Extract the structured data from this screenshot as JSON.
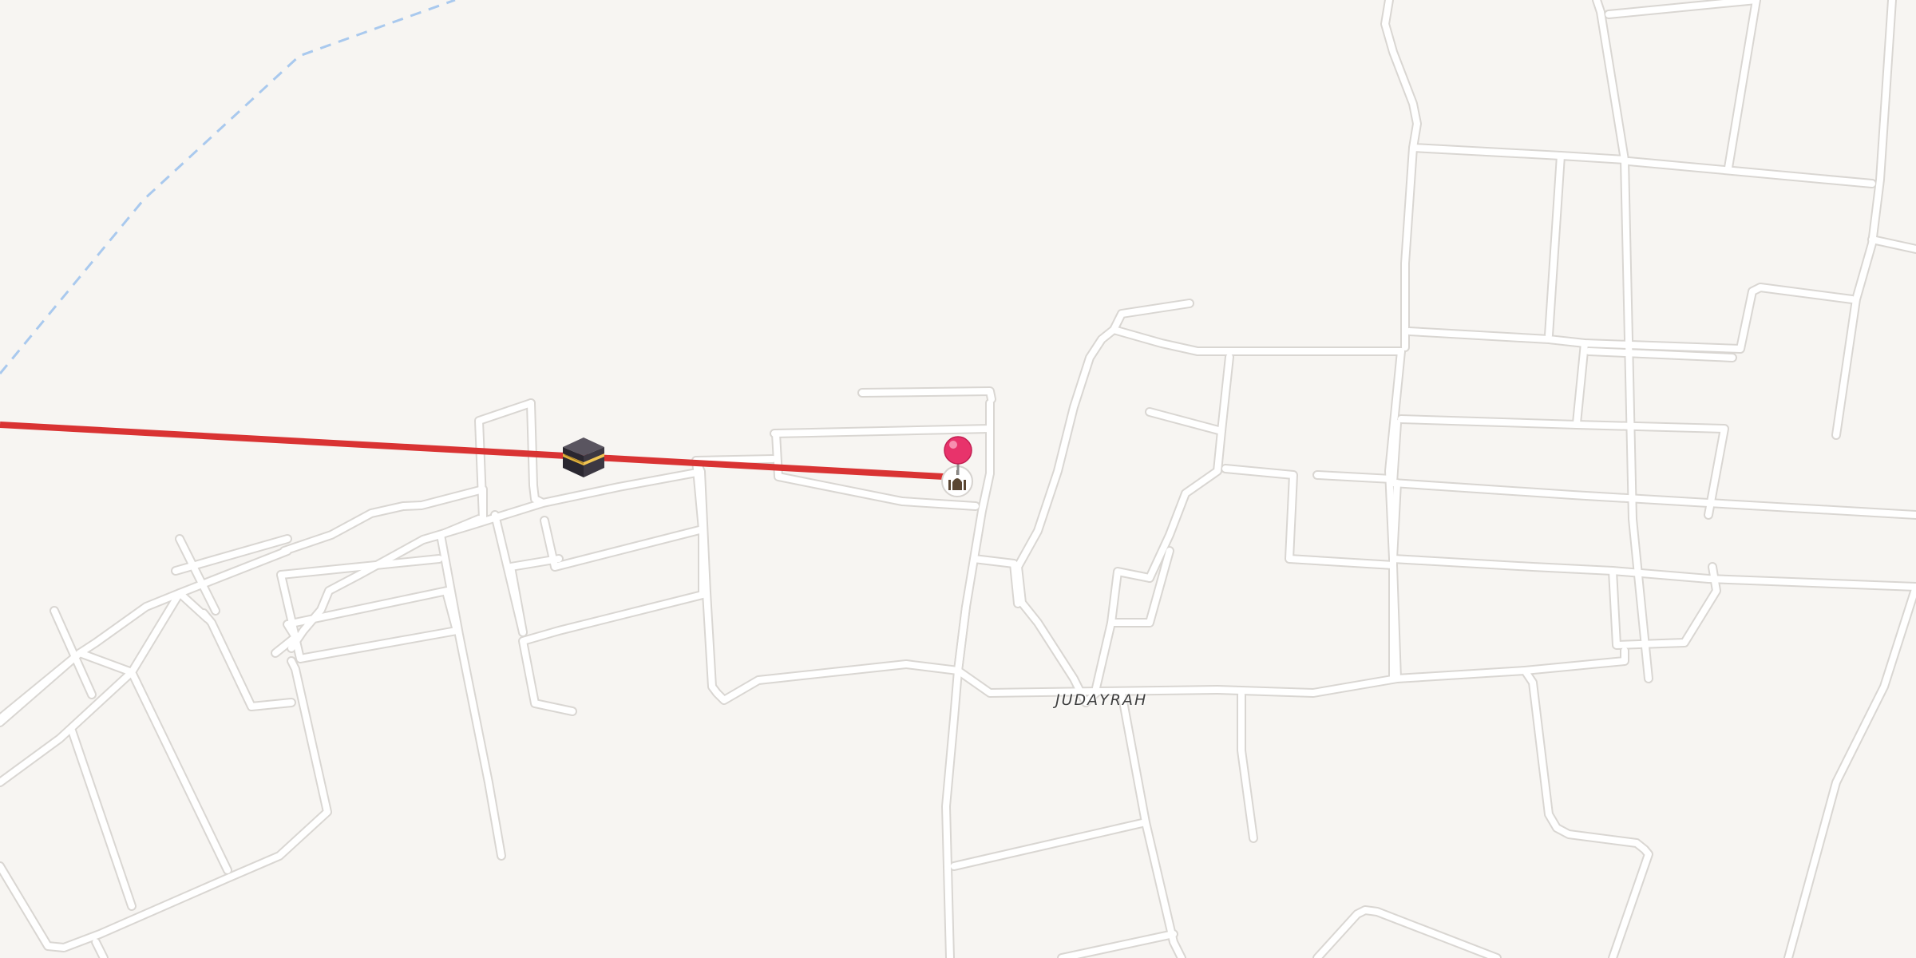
{
  "map": {
    "place_labels": [
      {
        "name": "JUDAYRAH"
      }
    ],
    "icons": {
      "kaaba_marker": "kaaba-icon",
      "selected_pin": "map-pin-icon",
      "poi": "mosque-icon"
    },
    "colors": {
      "background": "#f7f5f2",
      "road_fill": "#ffffff",
      "road_casing": "#d9d6d2",
      "route_line": "#d93333",
      "admin_boundary": "#a9c9ee",
      "pin": "#e8336b"
    }
  }
}
